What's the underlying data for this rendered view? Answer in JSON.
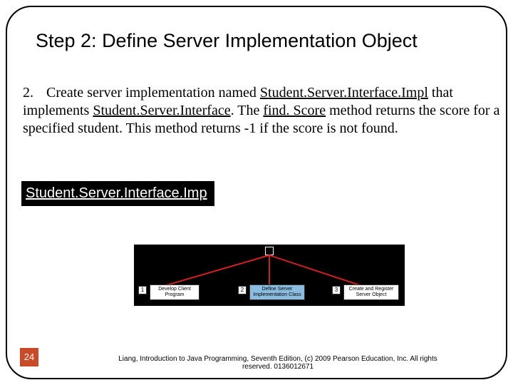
{
  "title": "Step 2: Define Server Implementation Object",
  "body": {
    "number": "2.",
    "text_before_u1": "Create server implementation named ",
    "u1": "Student.Server.Interface.Impl",
    "text_after_u1": " that implements ",
    "u2": "Student.Server.Interface",
    "text_after_u2": ". The ",
    "u3": "find. Score",
    "text_after_u3": " method returns the score for a specified student. This method returns -1 if the score is not found."
  },
  "code_link": "Student.Server.Interface.Imp",
  "diagram": {
    "box1_num": "1",
    "box1_label": "Develop Client Program",
    "box2_num": "2",
    "box2_label": "Define Server Implementation Class",
    "box3_num": "3",
    "box3_label": "Create and Register Server Object"
  },
  "page_number": "24",
  "footer": "Liang, Introduction to Java Programming, Seventh Edition, (c) 2009 Pearson Education, Inc. All rights reserved. 0136012671"
}
